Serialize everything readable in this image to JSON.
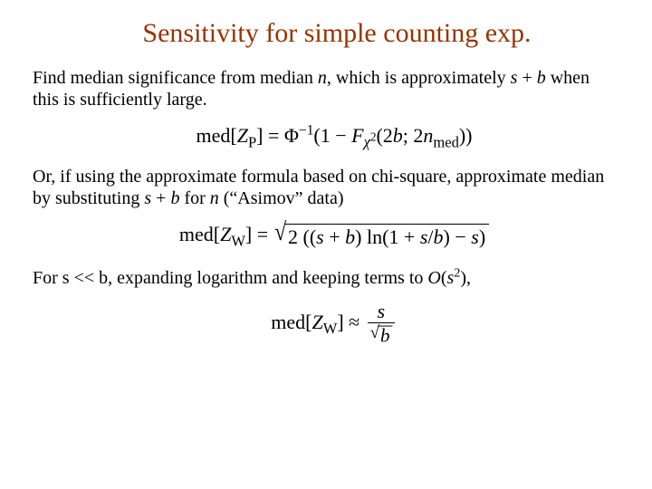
{
  "title": "Sensitivity for simple counting exp.",
  "para1_a": "Find median significance from median ",
  "para1_n": "n",
  "para1_b": ", which is approximately ",
  "para1_s": "s",
  "para1_plus": " + ",
  "para1_bvar": "b",
  "para1_c": " when this is sufficiently large.",
  "formula1": {
    "lhs_med": "med",
    "lhs_Z": "Z",
    "lhs_sub": "P",
    "eq": " = ",
    "phi": "Φ",
    "inv": "−1",
    "paren_open": "(1 − ",
    "F": "F",
    "chi2": "χ",
    "two": "2",
    "args": "(2",
    "b": "b",
    "semi": "; 2",
    "n": "n",
    "nmed": "med",
    "close": "))"
  },
  "para2_a": "Or, if using the approximate formula based on chi-square, approximate median by substituting ",
  "para2_s": "s",
  "para2_plus": " + ",
  "para2_b": "b",
  "para2_for": " for ",
  "para2_n": "n",
  "para2_c": " (“Asimov” data)",
  "formula2": {
    "lhs_med": "med",
    "lhs_Z": "Z",
    "lhs_sub": "W",
    "eq": " = ",
    "inside_a": "2 ((",
    "s1": "s",
    "plus1": " + ",
    "b1": "b",
    "ln": ") ln(1 + ",
    "s2": "s",
    "slash": "/",
    "b2": "b",
    "minus": ") − ",
    "s3": "s",
    "close": ")"
  },
  "para3_a": "For s << b, expanding logarithm and keeping terms to ",
  "para3_O": "O",
  "para3_open": "(",
  "para3_s": "s",
  "para3_sq": "2",
  "para3_close": "),",
  "formula3": {
    "lhs_med": "med",
    "lhs_Z": "Z",
    "lhs_sub": "W",
    "approx": " ≈ ",
    "num": "s",
    "den_b": "b"
  }
}
